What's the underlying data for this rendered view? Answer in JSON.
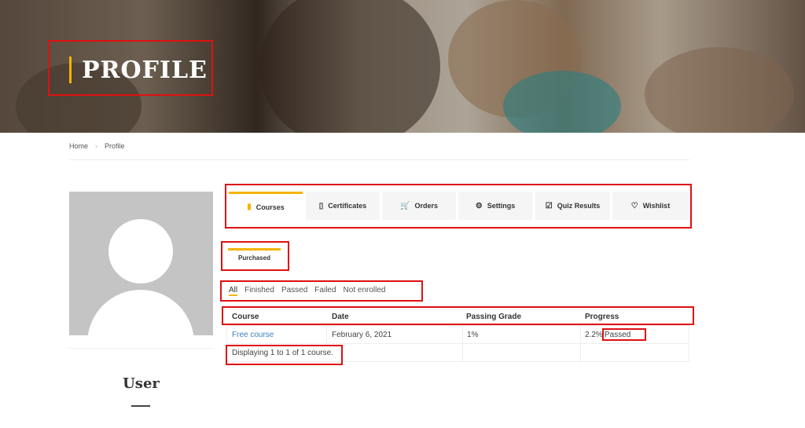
{
  "page": {
    "title": "PROFILE"
  },
  "breadcrumb": {
    "home": "Home",
    "current": "Profile"
  },
  "user": {
    "name": "User"
  },
  "tabs": [
    {
      "label": "Courses",
      "icon": "book-icon",
      "active": true
    },
    {
      "label": "Certificates",
      "icon": "bookmark-icon",
      "active": false
    },
    {
      "label": "Orders",
      "icon": "cart-icon",
      "active": false
    },
    {
      "label": "Settings",
      "icon": "gear-icon",
      "active": false
    },
    {
      "label": "Quiz Results",
      "icon": "checkbox-icon",
      "active": false
    },
    {
      "label": "Wishlist",
      "icon": "heart-icon",
      "active": false
    }
  ],
  "subtab": {
    "label": "Purchased"
  },
  "filters": [
    "All",
    "Finished",
    "Passed",
    "Failed",
    "Not enrolled"
  ],
  "table": {
    "headers": {
      "course": "Course",
      "date": "Date",
      "grade": "Passing Grade",
      "progress": "Progress"
    },
    "rows": [
      {
        "course": "Free course",
        "date": "February 6, 2021",
        "grade": "1%",
        "progress": "2.2%",
        "status": "Passed"
      }
    ],
    "footer": "Displaying 1 to 1 of 1 course."
  },
  "colors": {
    "accent": "#f5b400",
    "highlight": "#e01010",
    "link": "#3a7fbf"
  }
}
